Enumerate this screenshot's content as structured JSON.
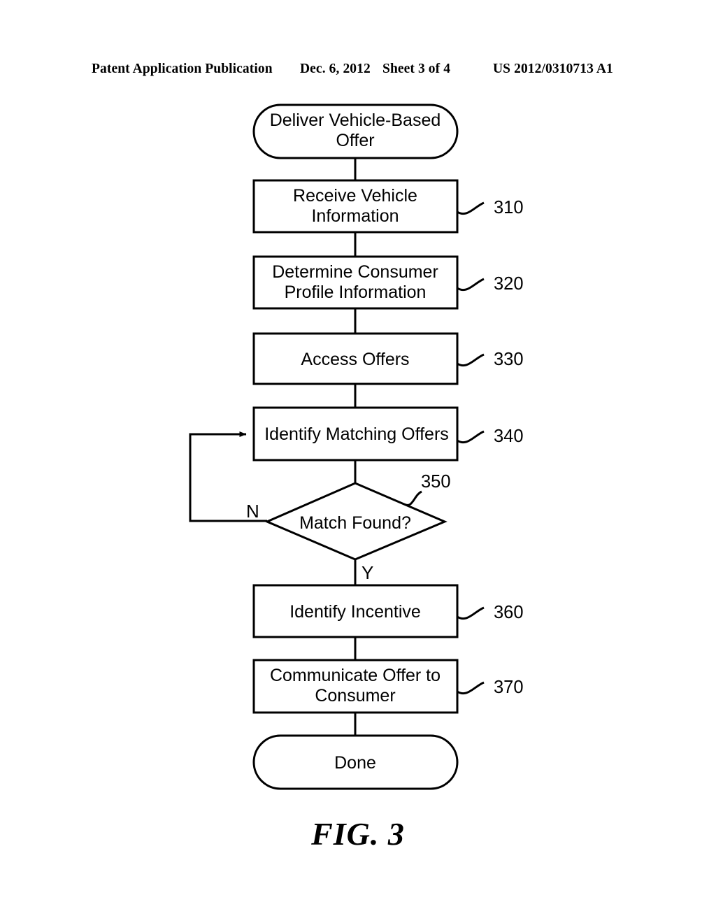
{
  "header": {
    "publication": "Patent Application Publication",
    "date": "Dec. 6, 2012",
    "sheet": "Sheet 3 of 4",
    "patent_number": "US 2012/0310713 A1"
  },
  "figure": {
    "caption": "FIG. 3",
    "nodes": [
      {
        "id": "start",
        "shape": "terminal",
        "label_line1": "Deliver Vehicle-Based",
        "label_line2": "Offer",
        "ref": null
      },
      {
        "id": "receive-vehicle-information",
        "shape": "process",
        "label_line1": "Receive Vehicle",
        "label_line2": "Information",
        "ref": "310"
      },
      {
        "id": "determine-consumer-profile",
        "shape": "process",
        "label_line1": "Determine Consumer",
        "label_line2": "Profile Information",
        "ref": "320"
      },
      {
        "id": "access-offers",
        "shape": "process",
        "label_line1": "Access Offers",
        "label_line2": "",
        "ref": "330"
      },
      {
        "id": "identify-matching-offers",
        "shape": "process",
        "label_line1": "Identify Matching Offers",
        "label_line2": "",
        "ref": "340"
      },
      {
        "id": "match-found",
        "shape": "decision",
        "label_line1": "Match Found?",
        "label_line2": "",
        "ref": "350"
      },
      {
        "id": "identify-incentive",
        "shape": "process",
        "label_line1": "Identify Incentive",
        "label_line2": "",
        "ref": "360"
      },
      {
        "id": "communicate-offer-to-consumer",
        "shape": "process",
        "label_line1": "Communicate Offer to",
        "label_line2": "Consumer",
        "ref": "370"
      },
      {
        "id": "done",
        "shape": "terminal",
        "label_line1": "Done",
        "label_line2": "",
        "ref": null
      }
    ],
    "branch_labels": {
      "no": "N",
      "yes": "Y"
    },
    "colors": {
      "stroke": "#000000",
      "fill": "#ffffff",
      "text": "#000000"
    }
  }
}
